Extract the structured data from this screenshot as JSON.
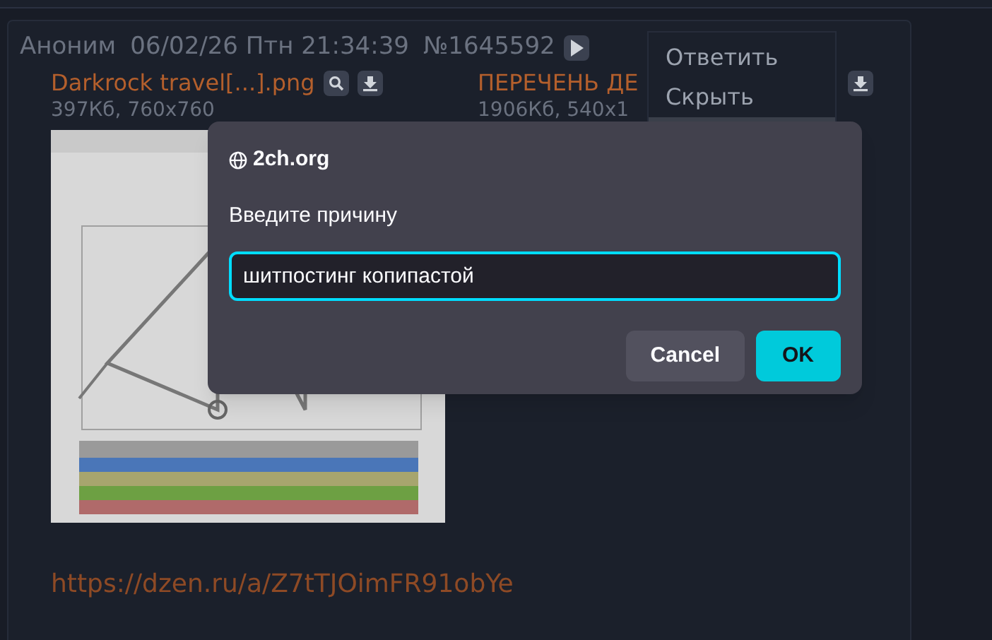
{
  "post": {
    "author": "Аноним",
    "date": "06/02/26 Птн 21:34:39",
    "number": "№1645592",
    "files": [
      {
        "name": "Darkrock travel[...].png",
        "meta": "397Кб, 760x760",
        "search": true,
        "thumbnail": true
      },
      {
        "name": "ПЕРЕЧЕНЬ ДЕ",
        "meta": "1906Кб, 540x1",
        "search": false,
        "thumbnail": false
      }
    ],
    "link": "https://dzen.ru/a/Z7tTJOimFR91obYe"
  },
  "menu": {
    "items": [
      {
        "label": "Ответить"
      },
      {
        "label": "Скрыть"
      }
    ]
  },
  "dialog": {
    "title": "2ch.org",
    "prompt": "Введите причину",
    "input": {
      "value": "шитпостинг копипастой"
    },
    "buttons": [
      {
        "label": "Cancel",
        "kind": "secondary"
      },
      {
        "label": "OK",
        "kind": "primary"
      }
    ]
  }
}
